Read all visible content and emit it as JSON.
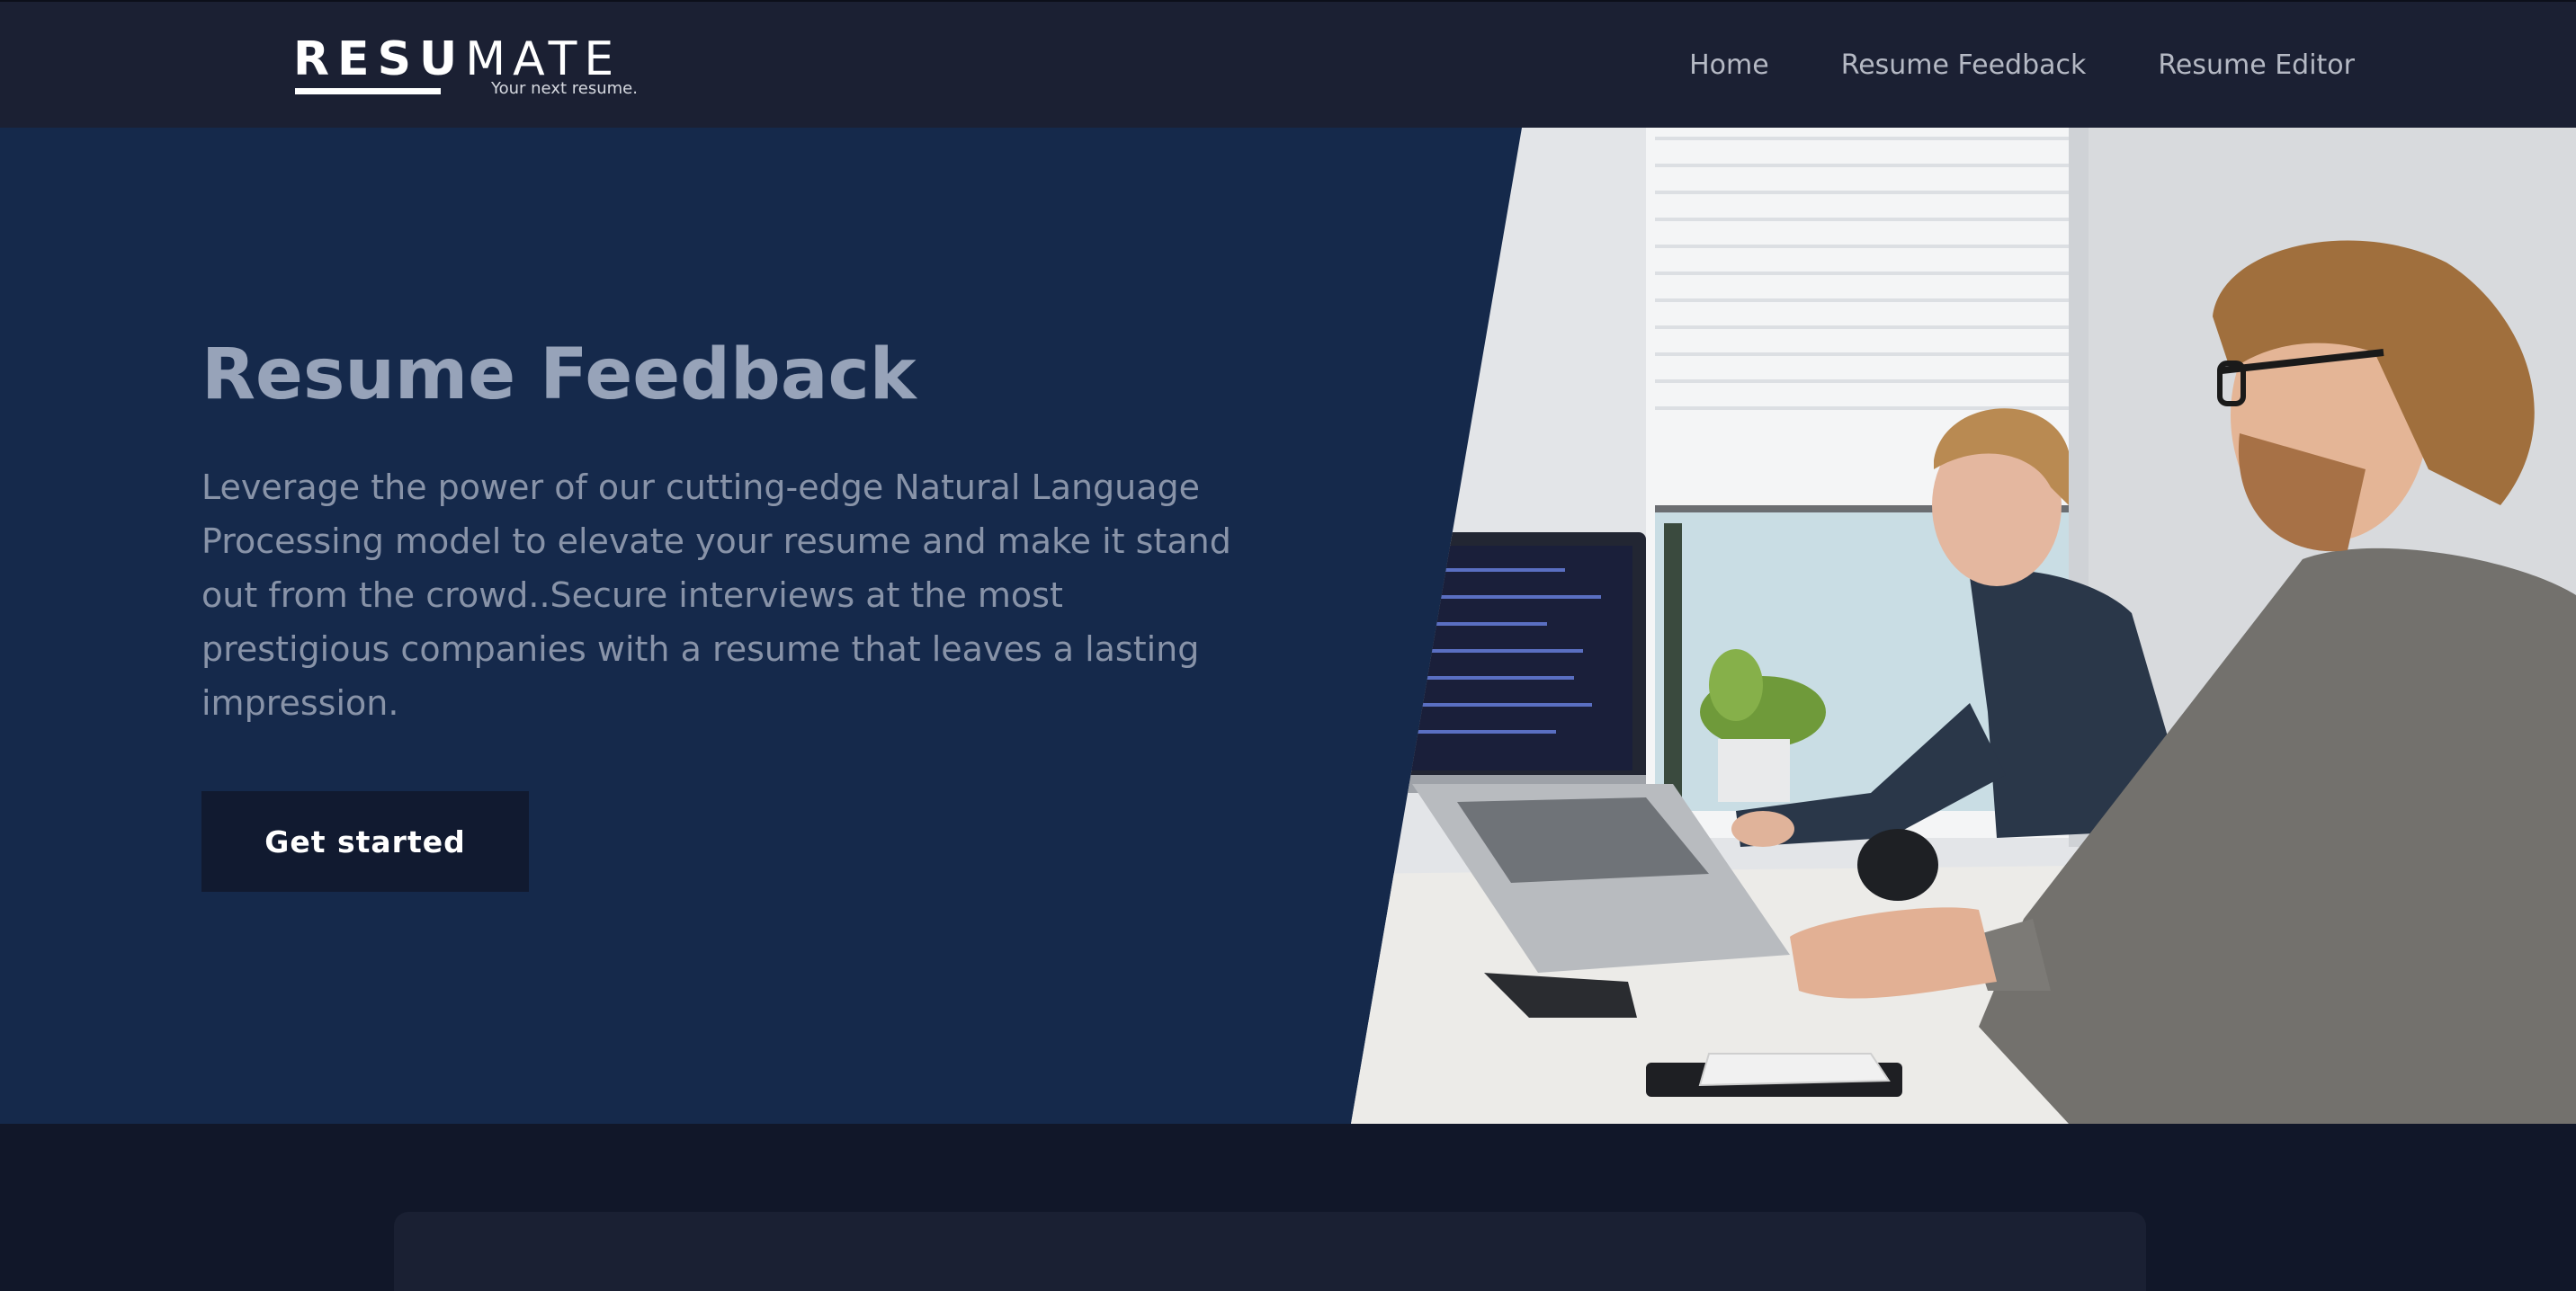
{
  "brand": {
    "bold": "RESU",
    "light": "MATE",
    "tagline": "Your next resume."
  },
  "nav": {
    "items": [
      {
        "label": "Home"
      },
      {
        "label": "Resume Feedback"
      },
      {
        "label": "Resume Editor"
      }
    ]
  },
  "hero": {
    "title": "Resume Feedback",
    "description": "Leverage the power of our cutting-edge Natural Language Processing model to elevate your resume and make it stand out from the crowd..Secure interviews at the most prestigious companies with a resume that leaves a lasting impression.",
    "cta_label": "Get started",
    "photo_icon": "office-workers-photo"
  },
  "colors": {
    "navbar": "#1b2033",
    "hero_bg": "#15294b",
    "page_bg": "#111729",
    "button": "#111a30",
    "title": "#97a3b9"
  }
}
